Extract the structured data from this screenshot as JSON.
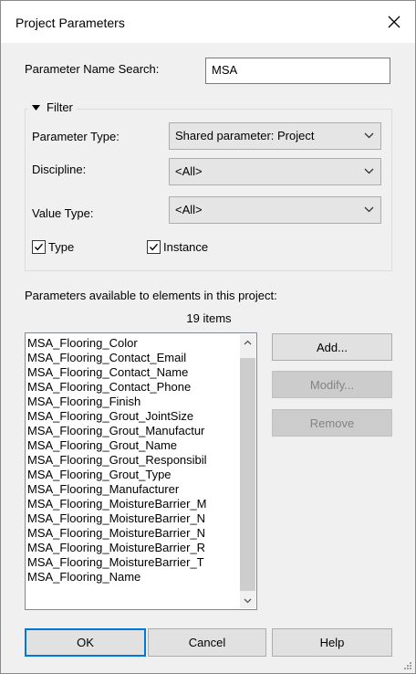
{
  "window": {
    "title": "Project Parameters"
  },
  "search": {
    "label": "Parameter Name Search:",
    "value": "MSA"
  },
  "filter": {
    "label": "Filter",
    "parameter_type_label": "Parameter Type:",
    "parameter_type_value": "Shared parameter: Project",
    "discipline_label": "Discipline:",
    "discipline_value": "<All>",
    "value_type_label": "Value Type:",
    "value_type_value": "<All>",
    "type_checkbox_label": "Type",
    "instance_checkbox_label": "Instance"
  },
  "parameters": {
    "header": "Parameters available to elements in this project:",
    "count": "19 items",
    "items": [
      "MSA_Flooring_Color",
      "MSA_Flooring_Contact_Email",
      "MSA_Flooring_Contact_Name",
      "MSA_Flooring_Contact_Phone",
      "MSA_Flooring_Finish",
      "MSA_Flooring_Grout_JointSize",
      "MSA_Flooring_Grout_Manufactur",
      "MSA_Flooring_Grout_Name",
      "MSA_Flooring_Grout_Responsibil",
      "MSA_Flooring_Grout_Type",
      "MSA_Flooring_Manufacturer",
      "MSA_Flooring_MoistureBarrier_M",
      "MSA_Flooring_MoistureBarrier_N",
      "MSA_Flooring_MoistureBarrier_N",
      "MSA_Flooring_MoistureBarrier_R",
      "MSA_Flooring_MoistureBarrier_T",
      "MSA_Flooring_Name"
    ]
  },
  "actions": {
    "add": "Add...",
    "modify": "Modify...",
    "remove": "Remove"
  },
  "footer": {
    "ok": "OK",
    "cancel": "Cancel",
    "help": "Help"
  },
  "colors": {
    "accent": "#0078d7",
    "dialog_bg": "#f0f0f0"
  },
  "icons": {
    "close": "close-icon",
    "filter_toggle": "triangle-down-icon",
    "combo": "chevron-down-icon",
    "check": "checkmark-icon"
  }
}
